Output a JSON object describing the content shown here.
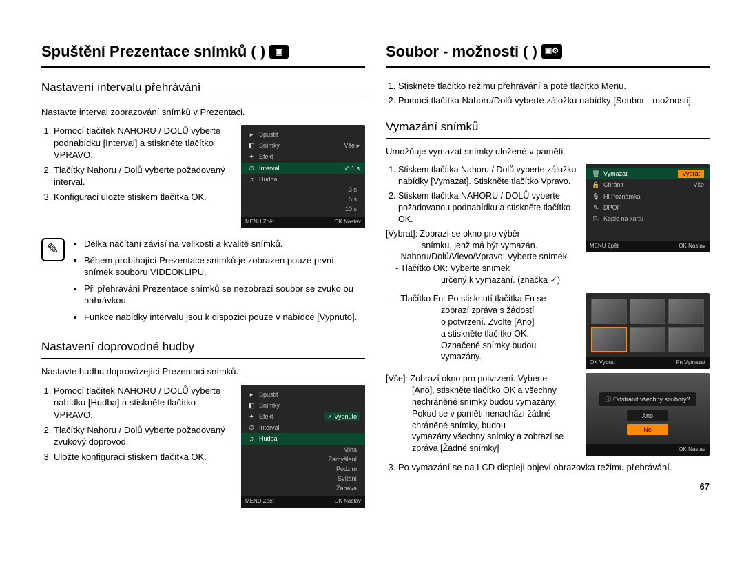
{
  "page_number": "67",
  "left": {
    "h1": "Spuštění Prezentace snímků (       )",
    "section_interval": {
      "h2": "Nastavení intervalu přehrávání",
      "intro": "Nastavte interval zobrazování snímků v Prezentaci.",
      "steps": [
        "Pomocí tlačítek NAHORU / DOLŮ vyberte podnabídku [Interval] a stiskněte tlačítko VPRAVO.",
        "Tlačítky Nahoru / Dolů vyberte požadovaný interval.",
        "Konfiguraci uložte stiskem tlačítka OK."
      ],
      "lcd": {
        "rows": [
          {
            "icon": "▸",
            "label": "Spustit",
            "val": ""
          },
          {
            "icon": "◧",
            "label": "Snímky",
            "val": "Vše     ▸"
          },
          {
            "icon": "✦",
            "label": "Efekt",
            "val": ""
          },
          {
            "icon": "⏱",
            "label": "Interval",
            "val": "✓ 1 s",
            "sel": true
          },
          {
            "icon": "♫",
            "label": "Hudba",
            "val": ""
          }
        ],
        "opts": [
          "3 s",
          "5 s",
          "10 s"
        ],
        "bar": {
          "l": "MENU  Zpět",
          "r": "OK  Nastav"
        }
      },
      "note": [
        "Délka načítání závisí na velikosti a kvalitě snímků.",
        "Během probíhající Prezentace snímků je zobrazen pouze první snímek souboru VIDEOKLIPU.",
        "Při přehrávání Prezentace snímků se nezobrazí soubor se zvuko ou nahrávkou.",
        "Funkce nabídky intervalu jsou k dispozici pouze v nabídce [Vypnuto]."
      ]
    },
    "section_music": {
      "h2": "Nastavení doprovodné hudby",
      "intro": "Nastavte hudbu doprovázející Prezentaci snímků.",
      "steps": [
        "Pomocí tlačítek NAHORU / DOLŮ vyberte nabídku [Hudba] a stiskněte tlačítko VPRAVO.",
        "Tlačítky Nahoru / Dolů vyberte požadovaný zvukový doprovod.",
        "Uložte konfiguraci stiskem tlačítka OK."
      ],
      "lcd": {
        "rows": [
          {
            "icon": "▸",
            "label": "Spustit",
            "val": ""
          },
          {
            "icon": "◧",
            "label": "Snímky",
            "val": ""
          },
          {
            "icon": "✦",
            "label": "Efekt",
            "val": "✓ Vypnuto",
            "valsel": true
          },
          {
            "icon": "⏱",
            "label": "Interval",
            "val": ""
          },
          {
            "icon": "♫",
            "label": "Hudba",
            "val": "",
            "sel": true
          }
        ],
        "opts": [
          "Mlha",
          "Zamyšlení",
          "Podzim",
          "Svítání",
          "Zábava"
        ],
        "bar": {
          "l": "MENU  Zpět",
          "r": "OK  Nastav"
        }
      }
    }
  },
  "right": {
    "h1": "Soubor - možnosti (       )",
    "intro_list": [
      "Stiskněte tlačítko režimu přehrávání a poté tlačítko Menu.",
      "Pomocí tlačítka Nahoru/Dolů vyberte záložku nabídky [Soubor - možnosti]."
    ],
    "section_delete": {
      "h2": "Vymazání snímků",
      "intro": "Umožňuje vymazat snímky uložené v paměti.",
      "steps": [
        "Stiskem tlačítka Nahoru / Dolů vyberte záložku nabídky [Vymazat]. Stiskněte tlačítko Vpravo.",
        "Stiskem tlačítka NAHORU / DOLŮ vyberte požadovanou podnabídku a stiskněte tlačítko OK."
      ],
      "lcd": {
        "rows": [
          {
            "icon": "🗑",
            "label": "Vymazat",
            "sel": true,
            "val": "Vybrat",
            "valsel": true
          },
          {
            "icon": "🔒",
            "label": "Chránit",
            "val": "Vše"
          },
          {
            "icon": "🎙",
            "label": "Hl.Poznámka",
            "val": ""
          },
          {
            "icon": "✎",
            "label": "DPOF",
            "val": ""
          },
          {
            "icon": "⎘",
            "label": "Kopie na kartu",
            "val": ""
          }
        ],
        "bar": {
          "l": "MENU  Zpět",
          "r": "OK  Nastav"
        }
      },
      "vybrat_label": "[Vybrat]: Zobrazí se okno pro výběr",
      "vybrat_line2": "snímku, jenž má být vymazán.",
      "vybrat_dash": [
        "Nahoru/Dolů/Vlevo/Vpravo: Vyberte snímek.",
        "Tlačítko OK: Vyberte snímek"
      ],
      "vybrat_mark": "určený k vymazání. (značka ✓)",
      "vybrat_fn": [
        "Tlačítko Fn: Po stisknutí  tlačítka Fn se",
        "zobrazí zpráva s žádostí",
        "o potvrzení. Zvolte [Ano]",
        "a stiskněte tlačítko OK.",
        "Označené snímky budou",
        "vymazány."
      ],
      "thumbs_bar": {
        "l": "OK  Vybrat",
        "r": "Fn  Vymazat"
      },
      "vse_label": "[Vše]: Zobrazí okno pro potvrzení. Vyberte",
      "vse_lines": [
        "[Ano], stiskněte tlačítko OK a všechny",
        "nechráněné snímky budou vymazány.",
        "Pokud se v paměti nenachází žádné chráněné snímky, budou",
        "vymazány všechny snímky a zobrazí se zpráva [Žádné snímky]"
      ],
      "dialog": {
        "q": "ⓘ Odstranit všechny soubory?",
        "yes": "Ano",
        "no": "Ne",
        "bar": "OK  Nastav"
      },
      "step3": "Po vymazání se na LCD displeji objeví obrazovka režimu přehrávání."
    }
  }
}
